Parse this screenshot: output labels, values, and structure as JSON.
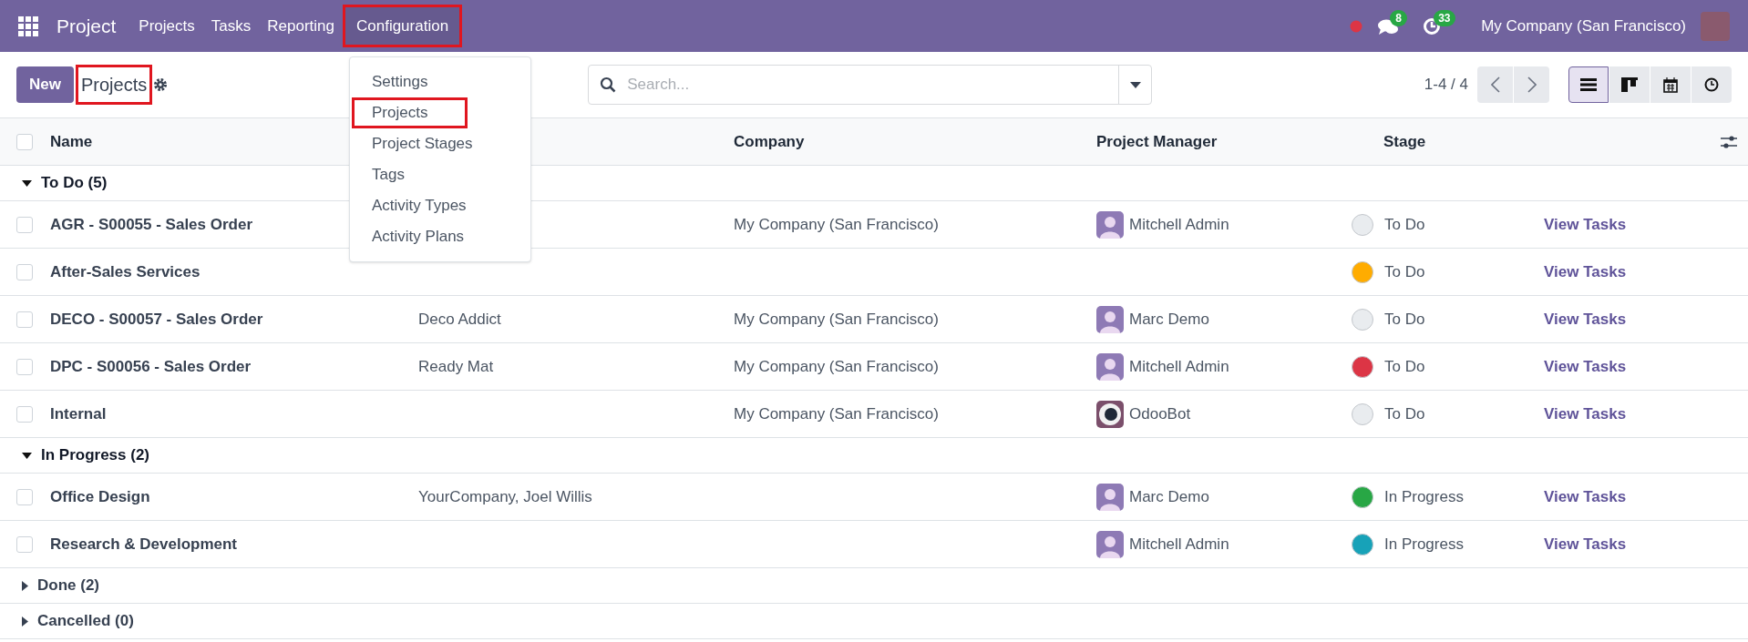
{
  "navbar": {
    "app_name": "Project",
    "menus": [
      {
        "label": "Projects",
        "highlighted": false
      },
      {
        "label": "Tasks",
        "highlighted": false
      },
      {
        "label": "Reporting",
        "highlighted": false
      },
      {
        "label": "Configuration",
        "highlighted": true
      }
    ],
    "messages_count": "8",
    "activities_count": "33",
    "company": "My Company (San Francisco)"
  },
  "control_panel": {
    "new_button": "New",
    "breadcrumb": {
      "label": "Projects",
      "highlighted": true
    },
    "search": {
      "placeholder": "Search..."
    },
    "pager": "1-4 / 4",
    "views": [
      {
        "kind": "list",
        "selected": true
      },
      {
        "kind": "kanban",
        "selected": false
      },
      {
        "kind": "calendar",
        "selected": false
      },
      {
        "kind": "activity",
        "selected": false
      }
    ]
  },
  "dropdown": {
    "items": [
      {
        "label": "Settings",
        "highlighted": false
      },
      {
        "label": "Projects",
        "highlighted": true
      },
      {
        "label": "Project Stages",
        "highlighted": false
      },
      {
        "label": "Tags",
        "highlighted": false
      },
      {
        "label": "Activity Types",
        "highlighted": false
      },
      {
        "label": "Activity Plans",
        "highlighted": false
      }
    ]
  },
  "table": {
    "all_checked": false,
    "columns": {
      "name": "Name",
      "company": "Company",
      "manager": "Project Manager",
      "stage": "Stage"
    },
    "groups": [
      {
        "label": "To Do (5)",
        "expanded": true,
        "rows": [
          {
            "name": "AGR - S00055 - Sales Order",
            "checked": false,
            "customer": "",
            "company": "My Company (San Francisco)",
            "manager": "Mitchell Admin",
            "kind": "person",
            "stage": "To Do",
            "color": "#e9ecef",
            "link": "View Tasks"
          },
          {
            "name": "After-Sales Services",
            "checked": false,
            "customer": "",
            "company": "",
            "manager": "",
            "stage": "To Do",
            "color": "#ffac00",
            "link": "View Tasks"
          },
          {
            "name": "DECO - S00057 - Sales Order",
            "checked": false,
            "customer": "Deco Addict",
            "company": "My Company (San Francisco)",
            "manager": "Marc Demo",
            "kind": "person",
            "stage": "To Do",
            "color": "#e9ecef",
            "link": "View Tasks"
          },
          {
            "name": "DPC - S00056 - Sales Order",
            "checked": false,
            "customer": "Ready Mat",
            "company": "My Company (San Francisco)",
            "manager": "Mitchell Admin",
            "kind": "person",
            "stage": "To Do",
            "color": "#dc3545",
            "link": "View Tasks"
          },
          {
            "name": "Internal",
            "checked": false,
            "customer": "",
            "company": "My Company (San Francisco)",
            "manager": "OdooBot",
            "kind": "bot",
            "stage": "To Do",
            "color": "#e9ecef",
            "link": "View Tasks"
          }
        ]
      },
      {
        "label": "In Progress (2)",
        "expanded": true,
        "rows": [
          {
            "name": "Office Design",
            "checked": false,
            "customer": "YourCompany, Joel Willis",
            "company": "",
            "manager": "Marc Demo",
            "kind": "person",
            "stage": "In Progress",
            "color": "#28a745",
            "link": "View Tasks"
          },
          {
            "name": "Research & Development",
            "checked": false,
            "customer": "",
            "company": "",
            "manager": "Mitchell Admin",
            "kind": "person",
            "stage": "In Progress",
            "color": "#17a2b8",
            "link": "View Tasks"
          }
        ]
      },
      {
        "label": "Done (2)",
        "expanded": false
      },
      {
        "label": "Cancelled (0)",
        "expanded": false
      }
    ]
  }
}
